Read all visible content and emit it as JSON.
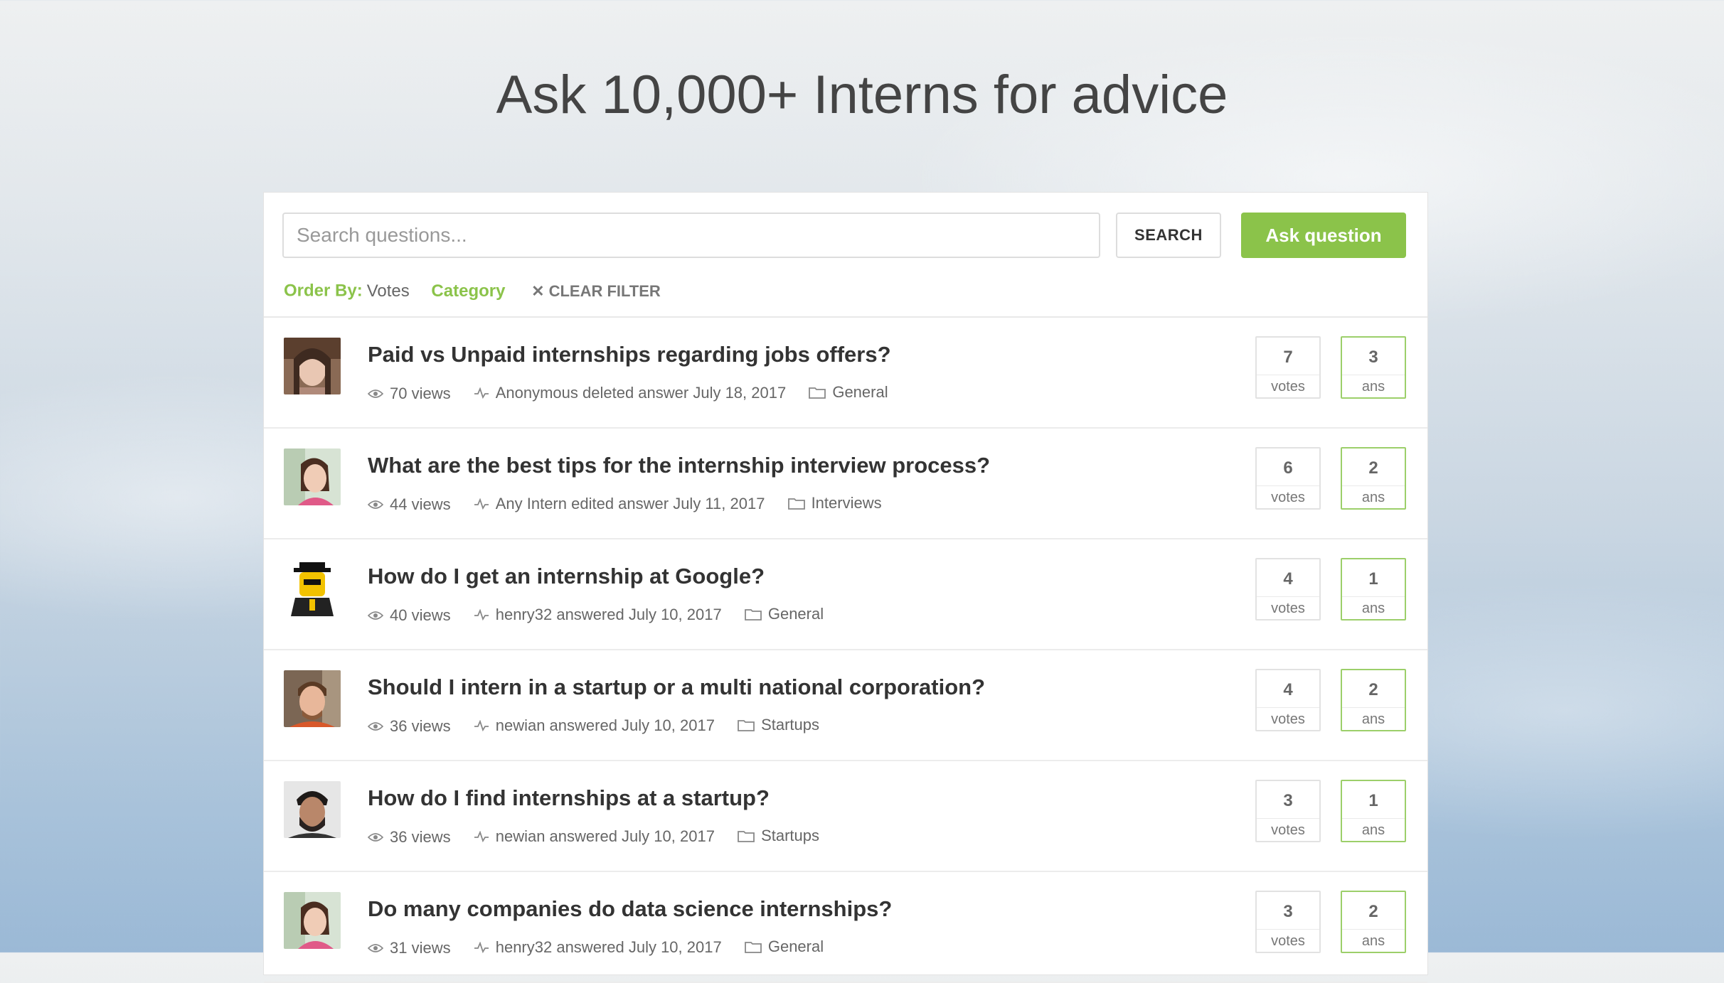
{
  "hero": {
    "title": "Ask 10,000+ Interns for advice"
  },
  "search": {
    "placeholder": "Search questions...",
    "button_label": "SEARCH"
  },
  "ask_button": {
    "label": "Ask question"
  },
  "filters": {
    "order_by_label": "Order By:",
    "order_by_value": "Votes",
    "category_label": "Category",
    "clear_label": "CLEAR FILTER"
  },
  "colors": {
    "accent": "#8bc34a",
    "text": "#333333",
    "muted": "#666666"
  },
  "icons": {
    "views": "eye-icon",
    "activity": "activity-pulse-icon",
    "category": "folder-icon",
    "clear": "close-icon"
  },
  "questions": [
    {
      "title": "Paid vs Unpaid internships regarding jobs offers?",
      "views": "70 views",
      "activity": "Anonymous deleted answer July 18, 2017",
      "category": "General",
      "votes": "7",
      "votes_label": "votes",
      "answers": "3",
      "answers_label": "ans"
    },
    {
      "title": "What are the best tips for the internship interview process?",
      "views": "44 views",
      "activity": "Any Intern edited answer July 11, 2017",
      "category": "Interviews",
      "votes": "6",
      "votes_label": "votes",
      "answers": "2",
      "answers_label": "ans"
    },
    {
      "title": "How do I get an internship at Google?",
      "views": "40 views",
      "activity": "henry32 answered July 10, 2017",
      "category": "General",
      "votes": "4",
      "votes_label": "votes",
      "answers": "1",
      "answers_label": "ans"
    },
    {
      "title": "Should I intern in a startup or a multi national corporation?",
      "views": "36 views",
      "activity": "newian answered July 10, 2017",
      "category": "Startups",
      "votes": "4",
      "votes_label": "votes",
      "answers": "2",
      "answers_label": "ans"
    },
    {
      "title": "How do I find internships at a startup?",
      "views": "36 views",
      "activity": "newian answered July 10, 2017",
      "category": "Startups",
      "votes": "3",
      "votes_label": "votes",
      "answers": "1",
      "answers_label": "ans"
    },
    {
      "title": "Do many companies do data science internships?",
      "views": "31 views",
      "activity": "henry32 answered July 10, 2017",
      "category": "General",
      "votes": "3",
      "votes_label": "votes",
      "answers": "2",
      "answers_label": "ans"
    }
  ]
}
